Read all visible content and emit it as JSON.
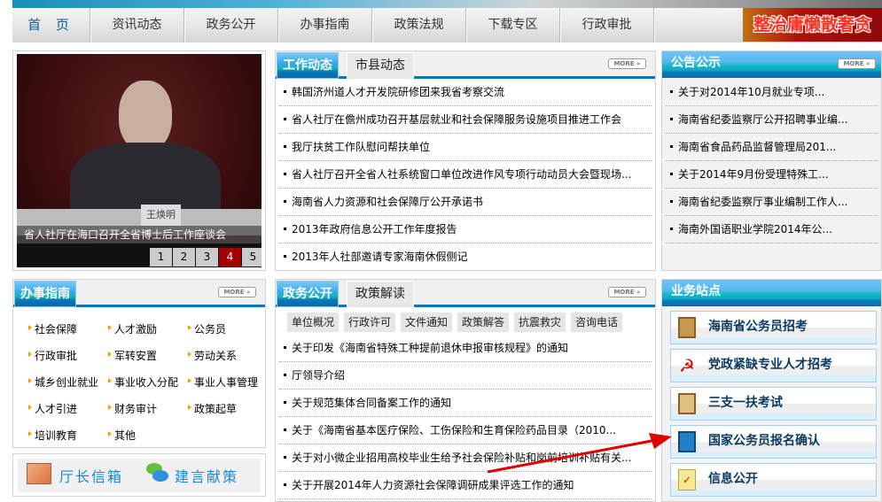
{
  "nav": {
    "items": [
      "首 页",
      "资讯动态",
      "政务公开",
      "办事指南",
      "政策法规",
      "下载专区",
      "行政审批"
    ],
    "banner_text": "整治庸懒散奢贪"
  },
  "slideshow": {
    "caption": "省人社厅在海口召开全省博士后工作座谈会",
    "nameplate": "王焕明",
    "pages": [
      "1",
      "2",
      "3",
      "4",
      "5"
    ],
    "active_page": "4"
  },
  "news": {
    "tabs": [
      "工作动态",
      "市县动态"
    ],
    "more": "MORE »",
    "items": [
      "韩国济州道人才开发院研修团来我省考察交流",
      "省人社厅在儋州成功召开基层就业和社会保障服务设施项目推进工作会",
      "我厅扶贫工作队慰问帮扶单位",
      "省人社厅召开全省人社系统窗口单位改进作风专项行动动员大会暨现场...",
      "海南省人力资源和社会保障厅公开承诺书",
      "2013年政府信息公开工作年度报告",
      "2013年人社部邀请专家海南休假侧记"
    ]
  },
  "notice": {
    "title": "公告公示",
    "more": "MORE »",
    "items": [
      "关于对2014年10月就业专项...",
      "海南省纪委监察厅公开招聘事业编...",
      "海南省食品药品监督管理局201...",
      "关于2014年9月份受理特殊工...",
      "海南省纪委监察厅事业编制工作人...",
      "海南外国语职业学院2014年公..."
    ]
  },
  "guide": {
    "title": "办事指南",
    "more": "MORE »",
    "items": [
      "社会保障",
      "人才激励",
      "公务员",
      "行政审批",
      "军转安置",
      "劳动关系",
      "城乡创业就业",
      "事业收入分配",
      "事业人事管理",
      "人才引进",
      "财务审计",
      "政策起草",
      "培训教育",
      "其他"
    ]
  },
  "mail": {
    "director_mailbox": "厅长信箱",
    "suggestions": "建言献策"
  },
  "affairs": {
    "tabs": [
      "政务公开",
      "政策解读"
    ],
    "more": "MORE »",
    "subtabs": [
      "单位概况",
      "行政许可",
      "文件通知",
      "政策解答",
      "抗震救灾",
      "咨询电话"
    ],
    "items": [
      "关于印发《海南省特殊工种提前退休申报审核规程》的通知",
      "厅领导介绍",
      "关于规范集体合同备案工作的通知",
      "关于《海南省基本医疗保险、工伤保险和生育保险药品目录（2010...",
      "关于对小微企业招用高校毕业生给予社会保险补贴和岗前培训补贴有关...",
      "关于开展2014年人力资源社会保障调研成果评选工作的通知"
    ]
  },
  "sites": {
    "title": "业务站点",
    "items": [
      "海南省公务员招考",
      "党政紧缺专业人才招考",
      "三支一扶考试",
      "国家公务员报名确认",
      "信息公开"
    ]
  },
  "colors": {
    "accent": "#0a78b8",
    "arrow": "#e00000",
    "active_page": "#a00000"
  }
}
